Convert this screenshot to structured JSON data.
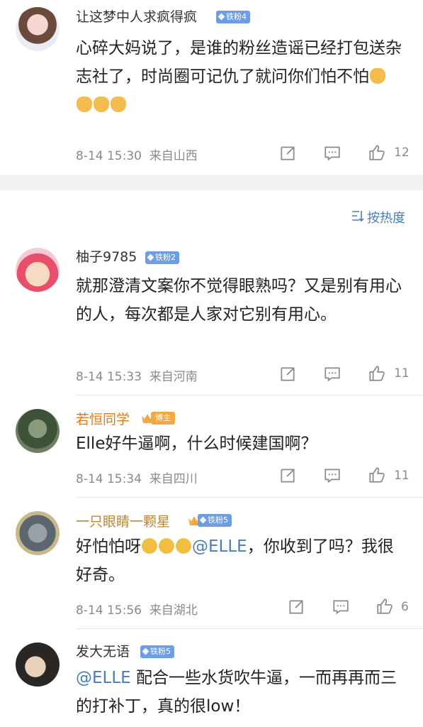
{
  "comments": [
    {
      "username": "让这梦中人求疯得疯",
      "badge": "铁粉4",
      "text": "心碎大妈说了，是谁的粉丝造谣已经打包送杂志社了，时尚圈可记仇了就问你们怕不怕",
      "time": "8-14 15:30",
      "location": "来自山西",
      "likes": "12"
    },
    {
      "username": "柚子9785",
      "badge": "铁粉2",
      "text": "就那澄清文案你不觉得眼熟吗？又是别有用心的人，每次都是人家对它别有用心。",
      "time": "8-14 15:33",
      "location": "来自河南",
      "likes": "11"
    },
    {
      "username": "若恒同学",
      "badge": "博主",
      "text": "Elle好牛逼啊，什么时候建国啊？",
      "time": "8-14 15:34",
      "location": "来自四川",
      "likes": "11"
    },
    {
      "username": "一只眼睛一颗星",
      "badge": "铁粉5",
      "text_before": "好怕怕呀",
      "mention": "@ELLE",
      "text_after": "，你收到了吗？我很好奇。",
      "time": "8-14 15:56",
      "location": "来自湖北",
      "likes": "6"
    },
    {
      "username": "发大无语",
      "badge": "铁粉5",
      "mention": "@ELLE",
      "text_after": " 配合一些水货吹牛逼，一而再再而三的打补丁，真的很low！"
    }
  ],
  "sort_label": "按热度",
  "icons": [
    "share-icon",
    "comment-icon",
    "like-icon",
    "sort-icon"
  ],
  "colors": {
    "accent": "#4a7db8",
    "badge_fan": "#6d9ee3",
    "badge_blogger": "#f4a742",
    "orange_name": "#e07a14",
    "gold_name": "#c4852a"
  }
}
